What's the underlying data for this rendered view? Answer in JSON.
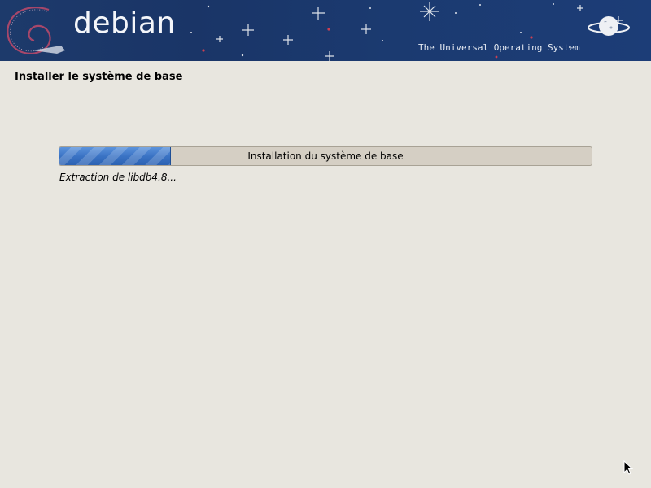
{
  "banner": {
    "logo_text": "debian",
    "tagline": "The Universal Operating System",
    "logo_icon": "debian-swirl-icon",
    "decoration_icon": "planet-icon"
  },
  "page": {
    "title": "Installer le système de base"
  },
  "progress": {
    "label": "Installation du système de base",
    "fraction": 0.21,
    "detail": "Extraction de libdb4.8..."
  },
  "cursor": {
    "icon": "mouse-pointer-icon"
  },
  "colors": {
    "banner_bg": "#1b3a6e",
    "background": "#e8e6df",
    "progress_fill": "#3a73c4",
    "progress_trough": "#d5cfc4"
  }
}
